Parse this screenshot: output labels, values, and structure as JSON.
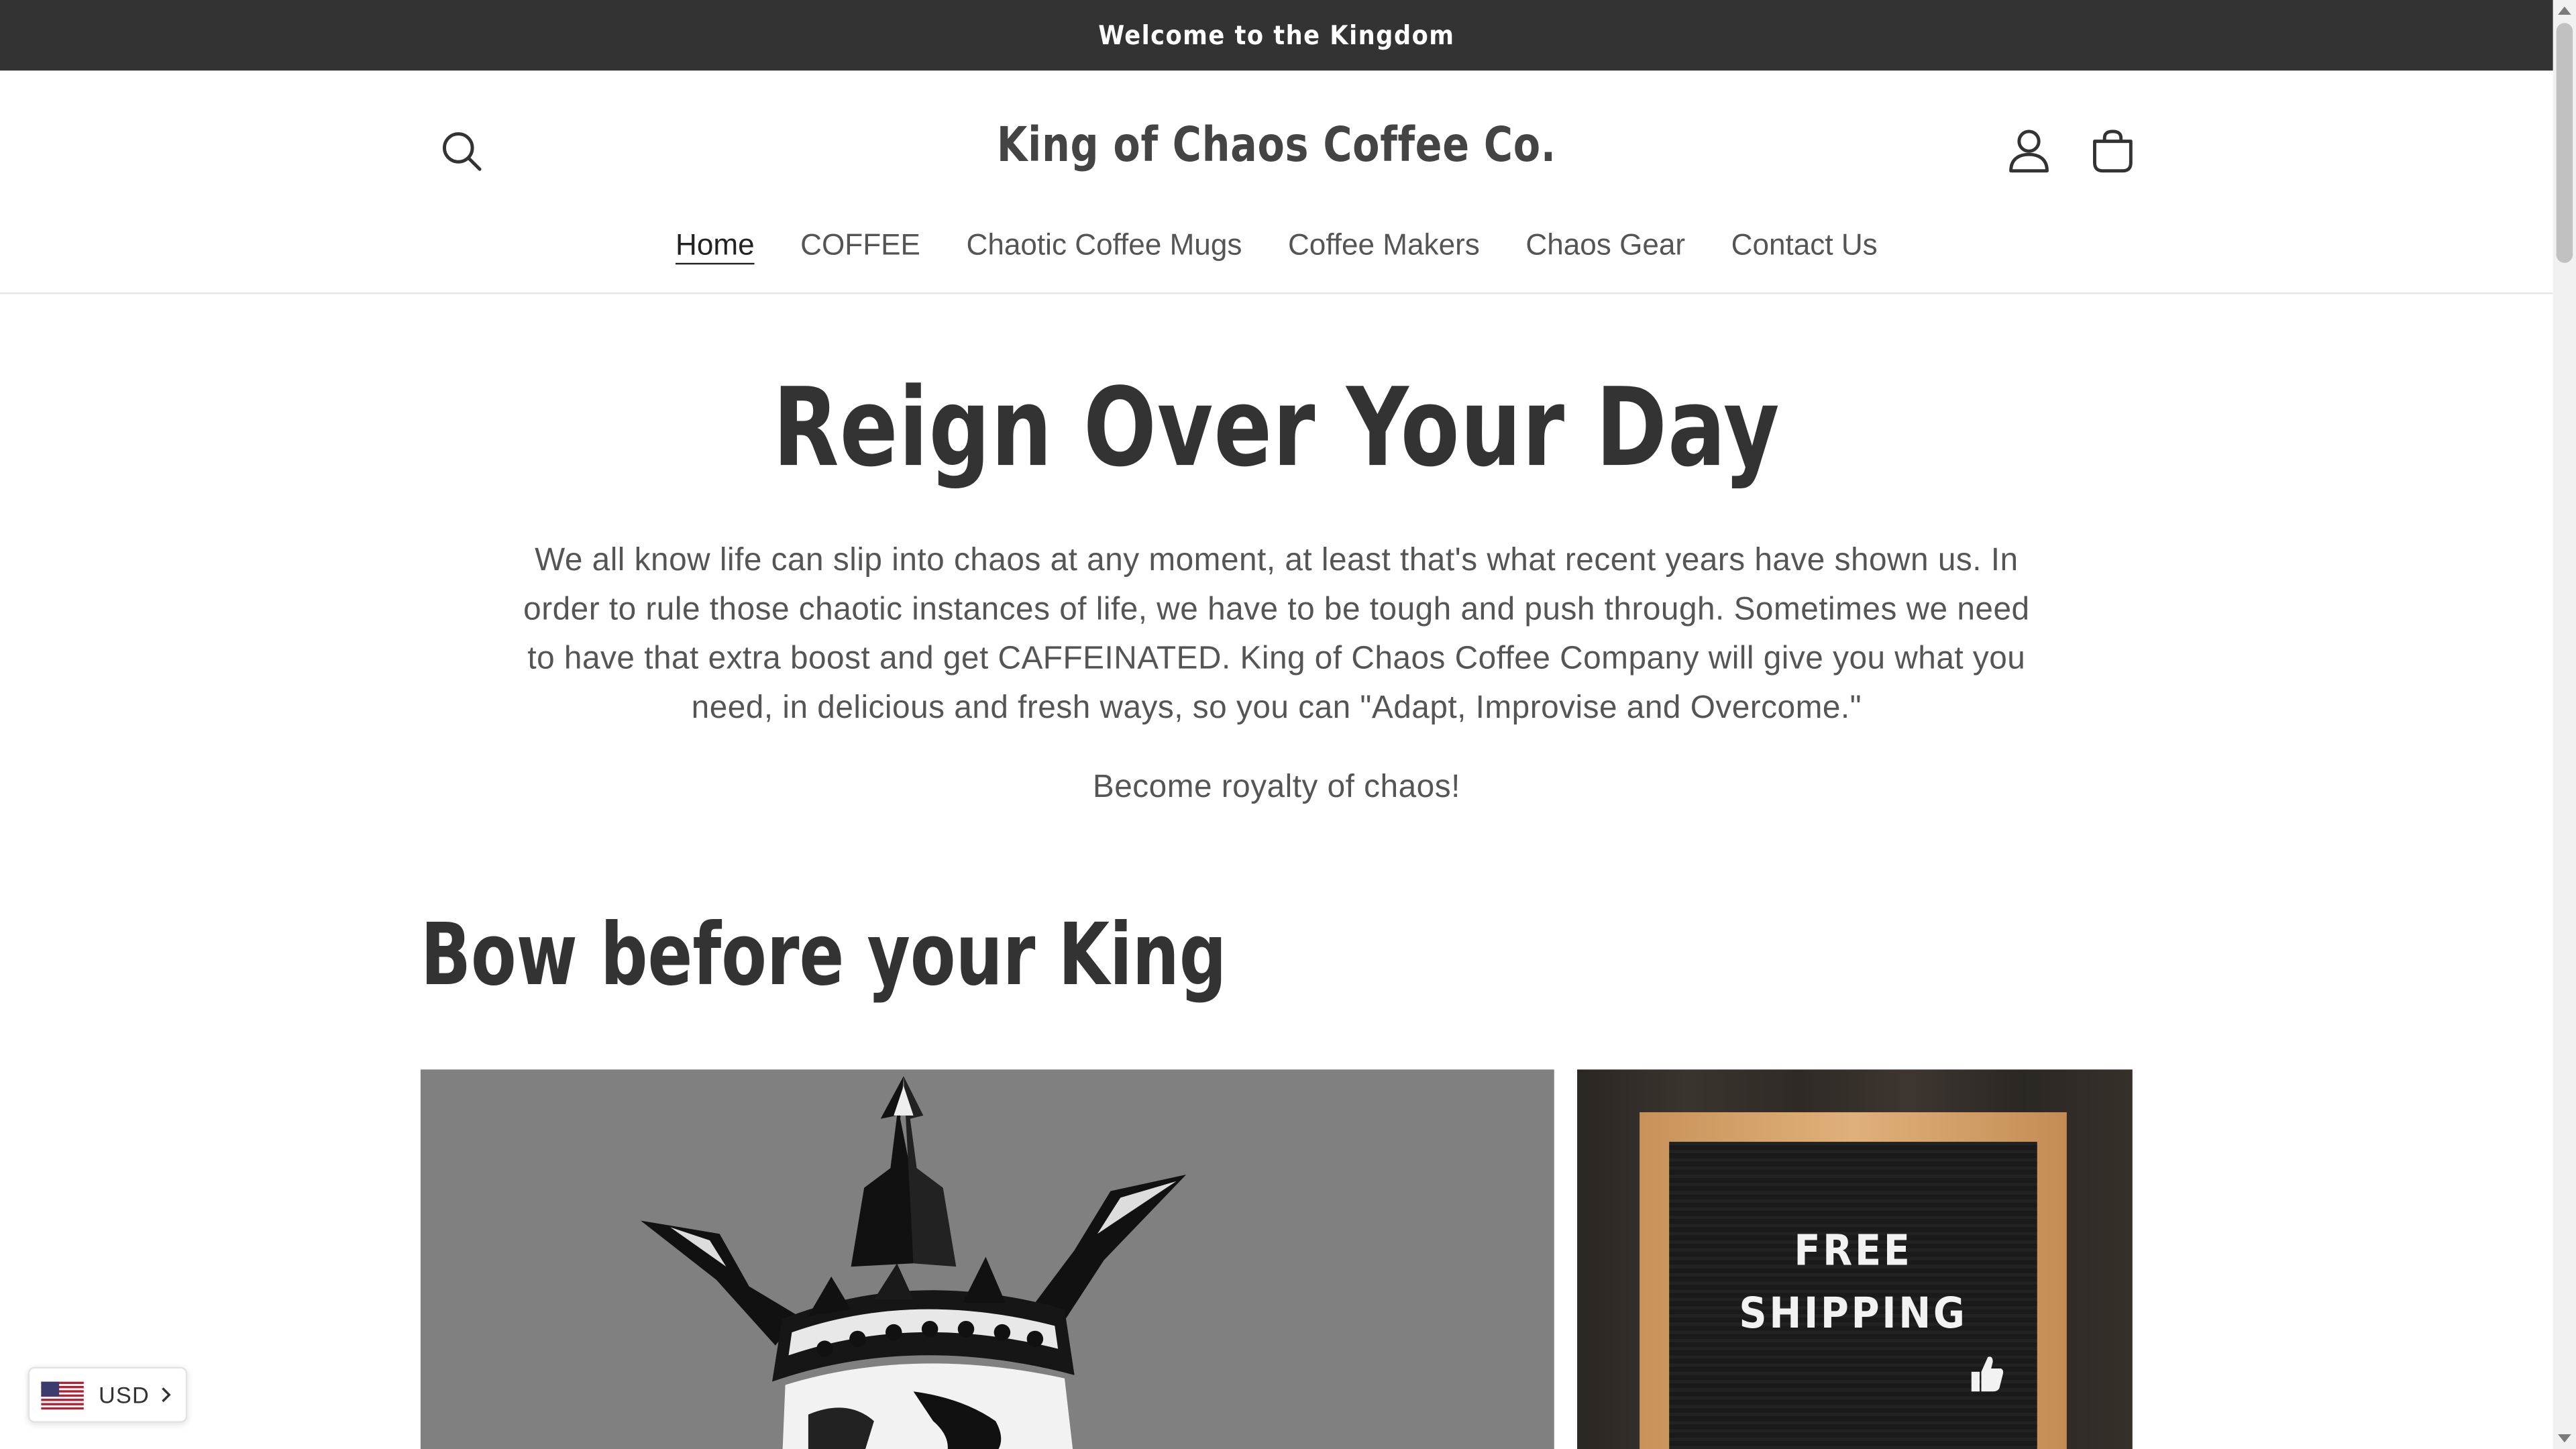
{
  "announcement": {
    "text": "Welcome to the Kingdom"
  },
  "header": {
    "brand": "King of Chaos Coffee Co.",
    "icons": {
      "search": "search-icon",
      "account": "account-icon",
      "cart": "cart-icon"
    }
  },
  "nav": {
    "items": [
      {
        "label": "Home",
        "active": true
      },
      {
        "label": "COFFEE",
        "active": false
      },
      {
        "label": "Chaotic Coffee Mugs",
        "active": false
      },
      {
        "label": "Coffee Makers",
        "active": false
      },
      {
        "label": "Chaos Gear",
        "active": false
      },
      {
        "label": "Contact Us",
        "active": false
      }
    ]
  },
  "hero": {
    "title": "Reign Over Your Day",
    "paragraph": "We all know life can slip into chaos at any moment, at least that's what recent years have shown us. In order to rule those chaotic instances of life, we have to be tough and push through. Sometimes we need to have that extra boost and get CAFFEINATED. King of Chaos Coffee Company will give you what you need, in delicious and fresh ways, so you can \"Adapt, Improvise and Overcome.\"",
    "tagline": "Become royalty of chaos!"
  },
  "featured": {
    "title": "Bow before your King",
    "side_sign": {
      "line1": "FREE",
      "line2": "SHIPPING"
    }
  },
  "currency": {
    "code": "USD",
    "flag": "us-flag-icon"
  },
  "colors": {
    "announcement_bg": "#333333",
    "text_dark": "#333333",
    "card_gray": "#808080"
  }
}
